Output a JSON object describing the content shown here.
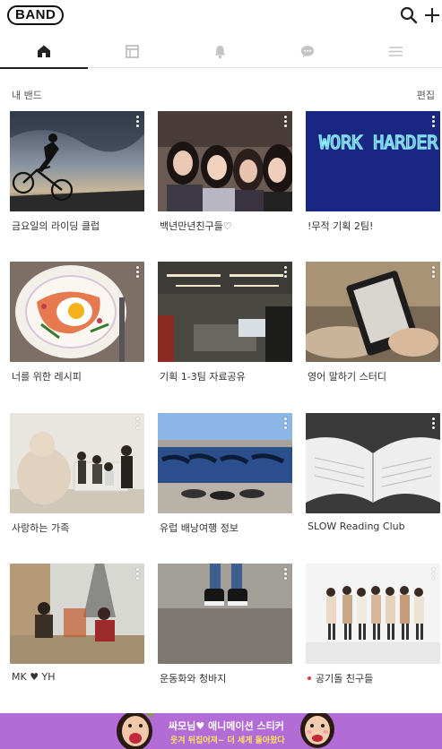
{
  "app": {
    "logo": "BAND"
  },
  "tabs": [
    {
      "id": "home",
      "icon": "home-icon",
      "active": true
    },
    {
      "id": "page",
      "icon": "page-icon",
      "active": false
    },
    {
      "id": "notifications",
      "icon": "bell-icon",
      "active": false
    },
    {
      "id": "chat",
      "icon": "chat-icon",
      "active": false
    },
    {
      "id": "menu",
      "icon": "menu-icon",
      "active": false
    }
  ],
  "section": {
    "title": "내 밴드",
    "edit_label": "편집"
  },
  "bands": [
    {
      "name": "금요일의 라이딩 클럽",
      "has_new": false
    },
    {
      "name": "백년만년친구들♡",
      "has_new": false
    },
    {
      "name": "!무적 기획 2팀!",
      "has_new": false
    },
    {
      "name": "너를 위한 레시피",
      "has_new": false
    },
    {
      "name": "기획 1-3팀 자료공유",
      "has_new": false
    },
    {
      "name": "영어 말하기 스터디",
      "has_new": false
    },
    {
      "name": "사랑하는 가족",
      "has_new": false
    },
    {
      "name": "유럽 배낭여행 정보",
      "has_new": false
    },
    {
      "name": "SLOW Reading Club",
      "has_new": false
    },
    {
      "name": "MK ♥ YH",
      "has_new": false
    },
    {
      "name": "운동화와 청바지",
      "has_new": false
    },
    {
      "name": "공기돌 친구들",
      "has_new": true
    }
  ],
  "banner": {
    "line1": "싸모님♥ 애니메이션 스티커",
    "line2": "웃겨 뒤집어져~ 더 세게 돌아왔다",
    "background": "#b36bd6"
  },
  "colors": {
    "accent": "#222222",
    "new_dot": "#e23c3c",
    "neon": "#4fd6ff"
  }
}
